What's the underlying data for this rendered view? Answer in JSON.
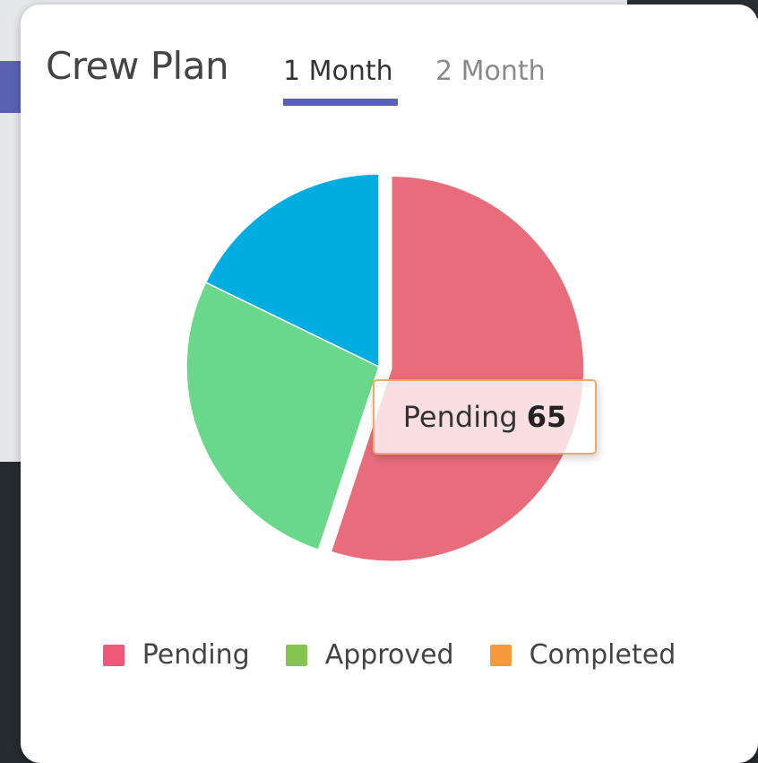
{
  "card": {
    "title": "Crew Plan",
    "tabs": [
      {
        "label": "1 Month",
        "active": true
      },
      {
        "label": "2 Month",
        "active": false
      }
    ],
    "accent_color": "#5961b2"
  },
  "chart_data": {
    "type": "pie",
    "slices": [
      {
        "label": "Pending",
        "value": 65,
        "color": "#e96c7a",
        "exploded": true
      },
      {
        "label": "Approved",
        "value": 32,
        "color": "#69d88a",
        "exploded": false
      },
      {
        "label": "Completed",
        "value": 21,
        "color": "#00ade0",
        "exploded": false
      }
    ],
    "tooltip": {
      "label": "Pending",
      "value": "65"
    },
    "legend": [
      {
        "label": "Pending",
        "color": "#f0587a"
      },
      {
        "label": "Approved",
        "color": "#85c34f"
      },
      {
        "label": "Completed",
        "color": "#f79a3e"
      }
    ],
    "legend_position": "bottom"
  }
}
